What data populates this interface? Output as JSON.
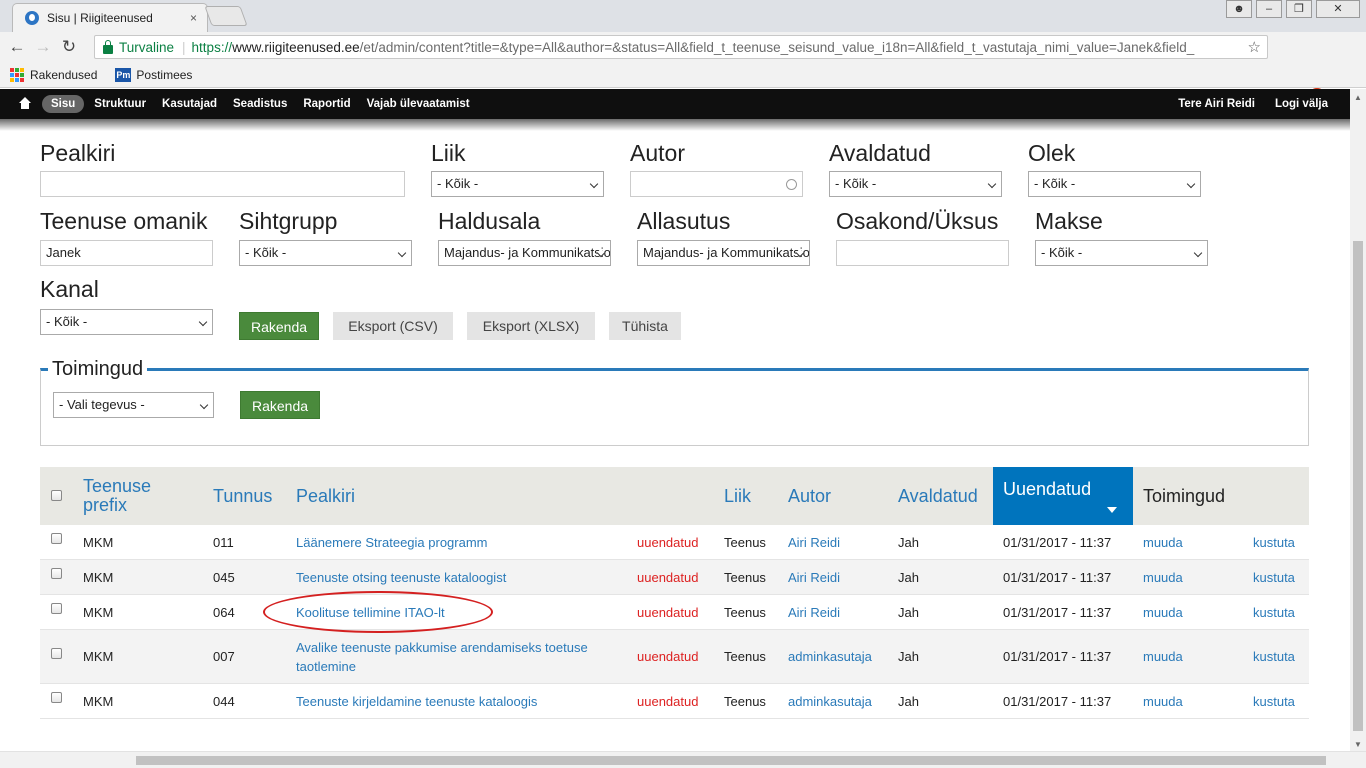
{
  "browser": {
    "tab_title": "Sisu | Riigiteenused",
    "tab_close": "×",
    "secure_label": "Turvaline",
    "url_scheme": "https://",
    "url_host": "www.riigiteenused.ee",
    "url_rest": "/et/admin/content?title=&type=All&author=&status=All&field_t_teenuse_seisund_value_i18n=All&field_t_vastutaja_nimi_value=Janek&field_",
    "bookmarks": [
      "Rakendused",
      "Postimees"
    ],
    "pm_badge": "Pm"
  },
  "admin_bar": {
    "items": [
      "Sisu",
      "Struktuur",
      "Kasutajad",
      "Seadistus",
      "Raportid",
      "Vajab ülevaatamist"
    ],
    "greeting_prefix": "Tere",
    "user_name": "Airi Reidi",
    "logout": "Logi välja"
  },
  "filters": {
    "title_label": "Pealkiri",
    "title_value": "",
    "type_label": "Liik",
    "type_value": "- Kõik -",
    "author_label": "Autor",
    "author_value": "",
    "published_label": "Avaldatud",
    "published_value": "- Kõik -",
    "state_label": "Olek",
    "state_value": "- Kõik -",
    "owner_label": "Teenuse omanik",
    "owner_value": "Janek",
    "target_label": "Sihtgrupp",
    "target_value": "- Kõik -",
    "domain_label": "Haldusala",
    "domain_value": "Majandus- ja Kommunikatsiooniministeerium",
    "agency_label": "Allasutus",
    "agency_value": "Majandus- ja Kommunikatsiooniministeerium",
    "dept_label": "Osakond/Üksus",
    "dept_value": "",
    "fee_label": "Makse",
    "fee_value": "- Kõik -",
    "channel_label": "Kanal",
    "channel_value": "- Kõik -",
    "apply": "Rakenda",
    "export_csv": "Eksport (CSV)",
    "export_xlsx": "Eksport (XLSX)",
    "reset": "Tühista"
  },
  "actions": {
    "legend": "Toimingud",
    "select_value": "- Vali tegevus -",
    "apply": "Rakenda"
  },
  "table": {
    "headers": {
      "prefix": "Teenuse prefix",
      "id": "Tunnus",
      "title": "Pealkiri",
      "type": "Liik",
      "author": "Autor",
      "published": "Avaldatud",
      "updated": "Uuendatud",
      "ops": "Toimingud"
    },
    "rows": [
      {
        "prefix": "MKM",
        "id": "011",
        "title": "Läänemere Strateegia programm",
        "flag": "uuendatud",
        "type": "Teenus",
        "author": "Airi Reidi",
        "published": "Jah",
        "updated": "01/31/2017 - 11:37",
        "edit": "muuda",
        "delete": "kustuta"
      },
      {
        "prefix": "MKM",
        "id": "045",
        "title": "Teenuste otsing teenuste kataloogist",
        "flag": "uuendatud",
        "type": "Teenus",
        "author": "Airi Reidi",
        "published": "Jah",
        "updated": "01/31/2017 - 11:37",
        "edit": "muuda",
        "delete": "kustuta"
      },
      {
        "prefix": "MKM",
        "id": "064",
        "title": "Koolituse tellimine ITAO-lt",
        "flag": "uuendatud",
        "type": "Teenus",
        "author": "Airi Reidi",
        "published": "Jah",
        "updated": "01/31/2017 - 11:37",
        "edit": "muuda",
        "delete": "kustuta"
      },
      {
        "prefix": "MKM",
        "id": "007",
        "title": "Avalike teenuste pakkumise arendamiseks toetuse taotlemine",
        "flag": "uuendatud",
        "type": "Teenus",
        "author": "adminkasutaja",
        "published": "Jah",
        "updated": "01/31/2017 - 11:37",
        "edit": "muuda",
        "delete": "kustuta"
      },
      {
        "prefix": "MKM",
        "id": "044",
        "title": "Teenuste kirjeldamine teenuste kataloogis",
        "flag": "uuendatud",
        "type": "Teenus",
        "author": "adminkasutaja",
        "published": "Jah",
        "updated": "01/31/2017 - 11:37",
        "edit": "muuda",
        "delete": "kustuta"
      }
    ]
  }
}
